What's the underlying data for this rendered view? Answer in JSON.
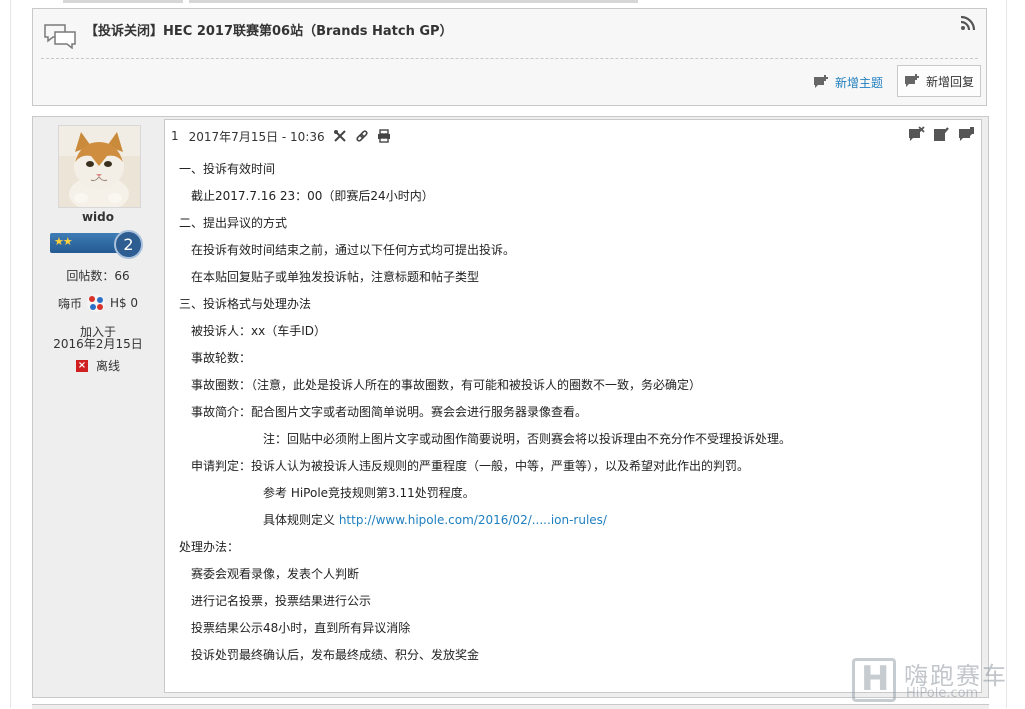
{
  "topic": {
    "title": "【投诉关闭】HEC 2017联赛第06站（Brands Hatch GP）",
    "new_topic_label": "新增主题",
    "new_reply_label": "新增回复"
  },
  "user": {
    "name": "wido",
    "rank_level": "2",
    "rank_stars": "★★",
    "posts_label": "回帖数：66",
    "coins_label": "嗨币",
    "coins_value": "H$ 0",
    "joined_label": "加入于",
    "joined_date": "2016年2月15日",
    "status": "离线"
  },
  "post": {
    "floor": "1",
    "datetime": "2017年7月15日 - 10:36",
    "lines": [
      "一、投诉有效时间",
      "　截止2017.7.16  23：00（即赛后24小时内）",
      "二、提出异议的方式",
      "　在投诉有效时间结束之前，通过以下任何方式均可提出投诉。",
      "　在本贴回复贴子或单独发投诉帖，注意标题和帖子类型",
      "三、投诉格式与处理办法",
      "　被投诉人：xx（车手ID）",
      "　事故轮数：",
      "　事故圈数：（注意，此处是投诉人所在的事故圈数，有可能和被投诉人的圈数不一致，务必确定）",
      "　事故简介：配合图片文字或者动图简单说明。赛会会进行服务器录像查看。",
      "　　　　　　　注：回贴中必须附上图片文字或动图作简要说明，否则赛会将以投诉理由不充分作不受理投诉处理。",
      "　申请判定：投诉人认为被投诉人违反规则的严重程度（一般，中等，严重等），以及希望对此作出的判罚。",
      "　　　　　　　参考 HiPole竞技规则第3.11处罚程度。",
      "　　　　　　　具体规则定义 ",
      "处理办法：",
      "　赛委会观看录像，发表个人判断",
      "　进行记名投票，投票结果进行公示",
      "　投票结果公示48小时，直到所有异议消除",
      "　投诉处罚最终确认后，发布最终成绩、积分、发放奖金"
    ],
    "rules_link": "http://www.hipole.com/2016/02/.....ion-rules/"
  },
  "watermark": {
    "cn": "嗨跑赛车",
    "en": "HiPole.com"
  },
  "colors": {
    "link": "#1f7fbf",
    "rank_blue": "#2e5d91",
    "offline_red": "#d01f1f"
  }
}
